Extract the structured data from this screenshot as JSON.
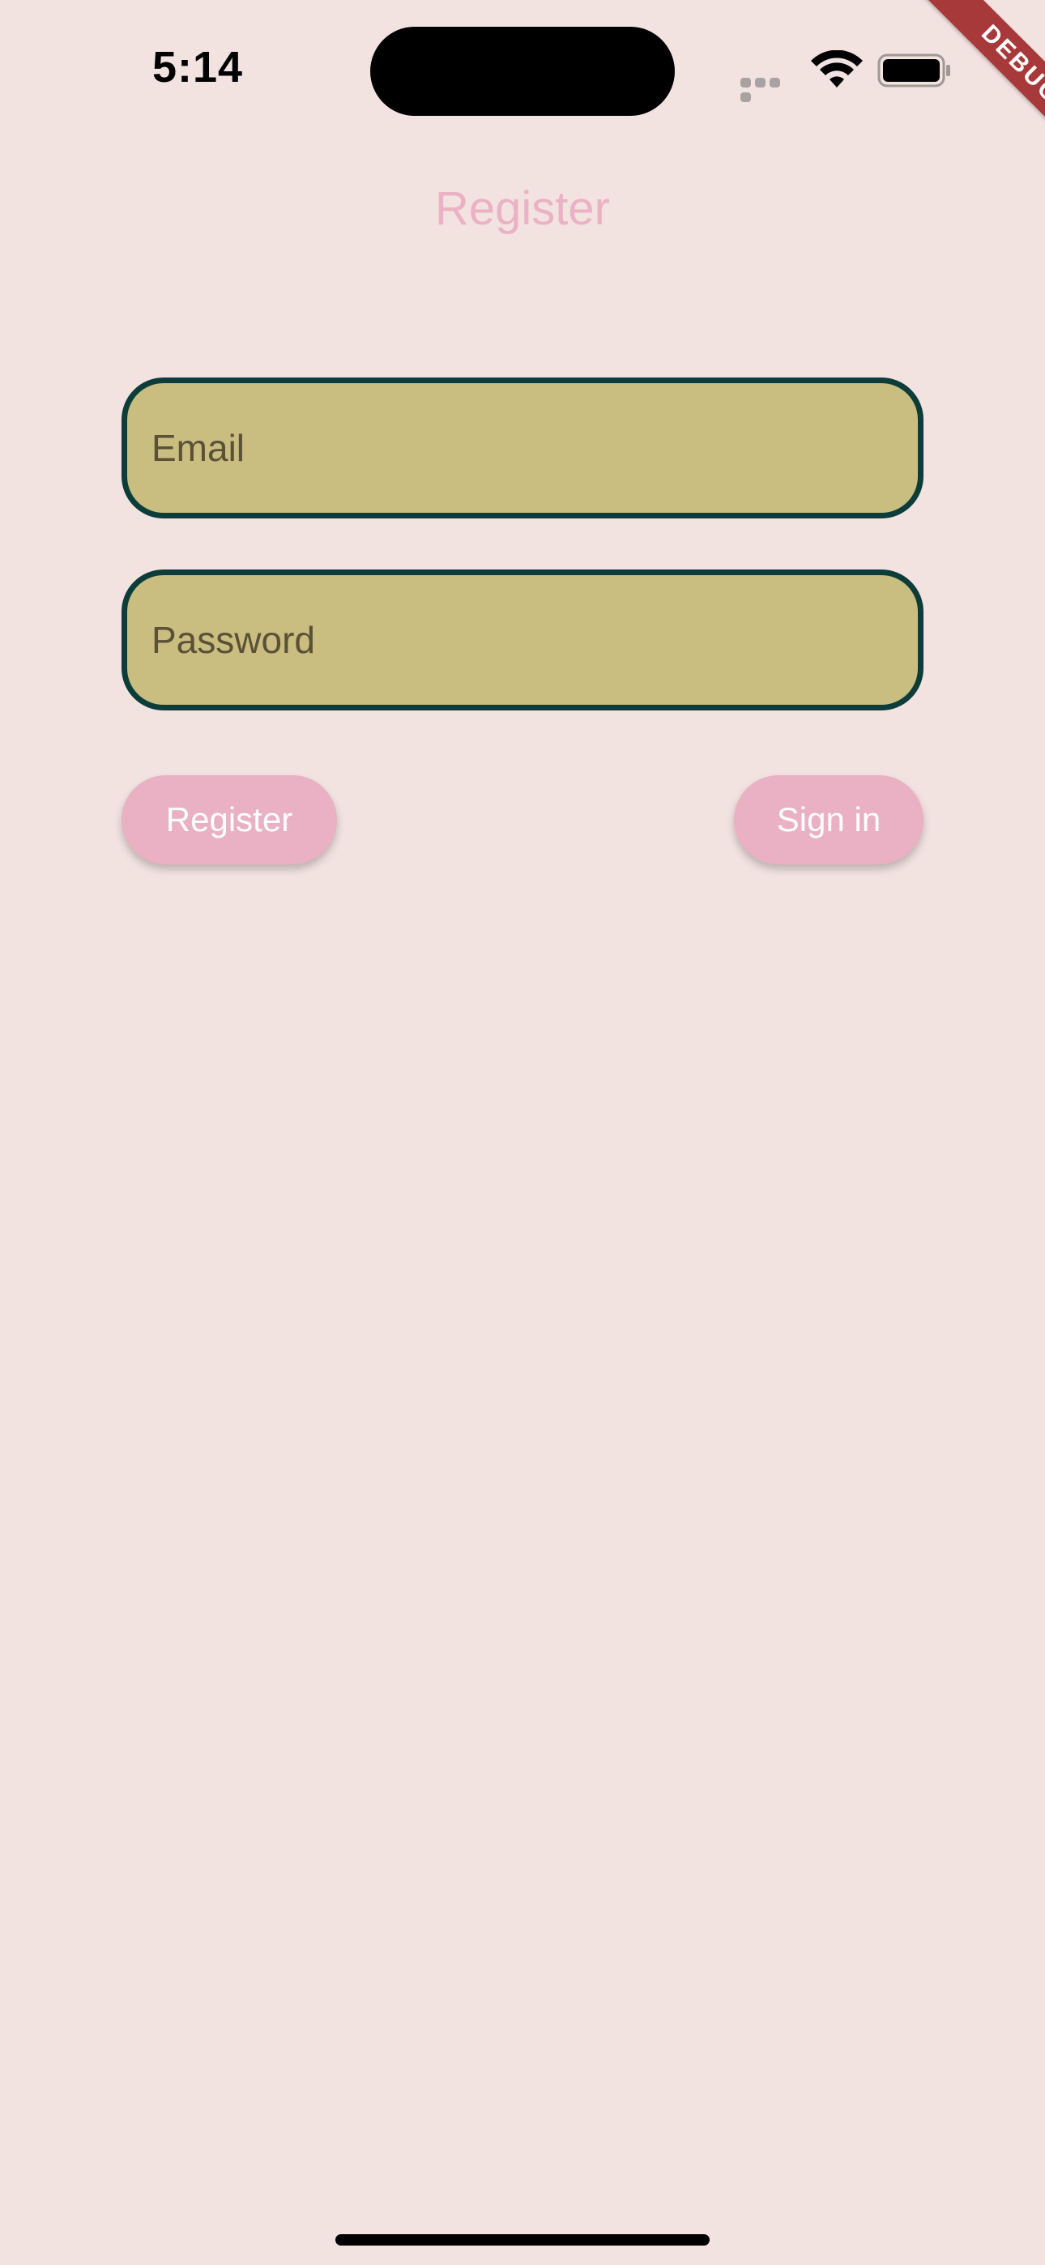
{
  "status_bar": {
    "time": "5:14",
    "wifi_icon": "wifi-icon",
    "battery_icon": "battery-icon"
  },
  "debug_banner": {
    "label": "DEBUG"
  },
  "page": {
    "title": "Register"
  },
  "form": {
    "email_placeholder": "Email",
    "email_value": "",
    "password_placeholder": "Password",
    "password_value": ""
  },
  "actions": {
    "register_label": "Register",
    "signin_label": "Sign in"
  },
  "colors": {
    "background": "#f2e3e1",
    "accent_pink": "#e9b1c3",
    "field_fill": "#c9bd80",
    "field_border": "#0c3d3a",
    "debug_ribbon": "#a8393b"
  }
}
